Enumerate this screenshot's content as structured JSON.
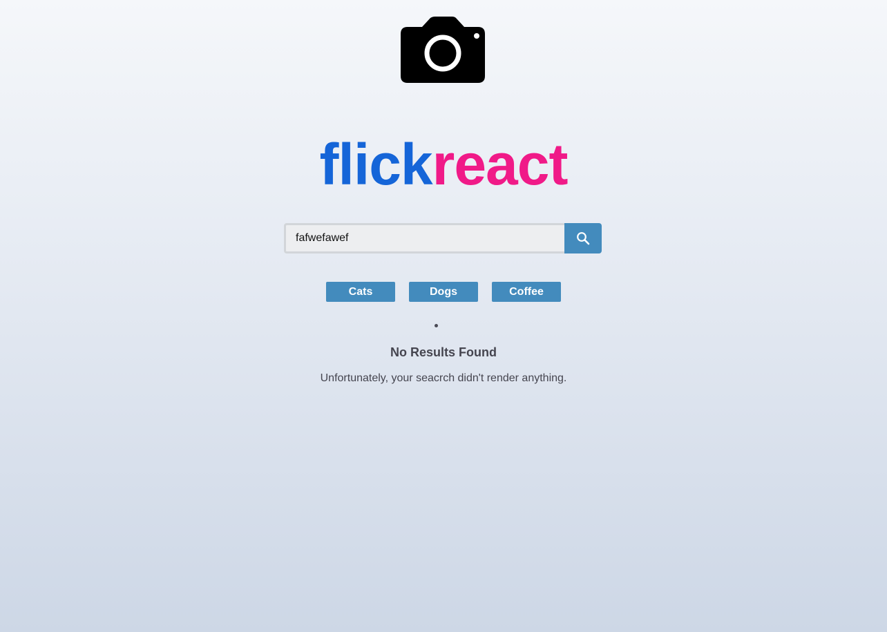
{
  "logo": {
    "part1": "flick",
    "part2": "react",
    "colors": {
      "part1": "#1565d8",
      "part2": "#f01a88"
    },
    "icon": "camera-icon"
  },
  "search": {
    "value": "fafwefawef",
    "placeholder": "Search",
    "button_icon": "search-icon",
    "button_color": "#438bbd"
  },
  "nav": {
    "items": [
      {
        "label": "Cats"
      },
      {
        "label": "Dogs"
      },
      {
        "label": "Coffee"
      }
    ]
  },
  "results": {
    "title": "No Results Found",
    "message": "Unfortunately, your seacrch didn't render anything."
  }
}
